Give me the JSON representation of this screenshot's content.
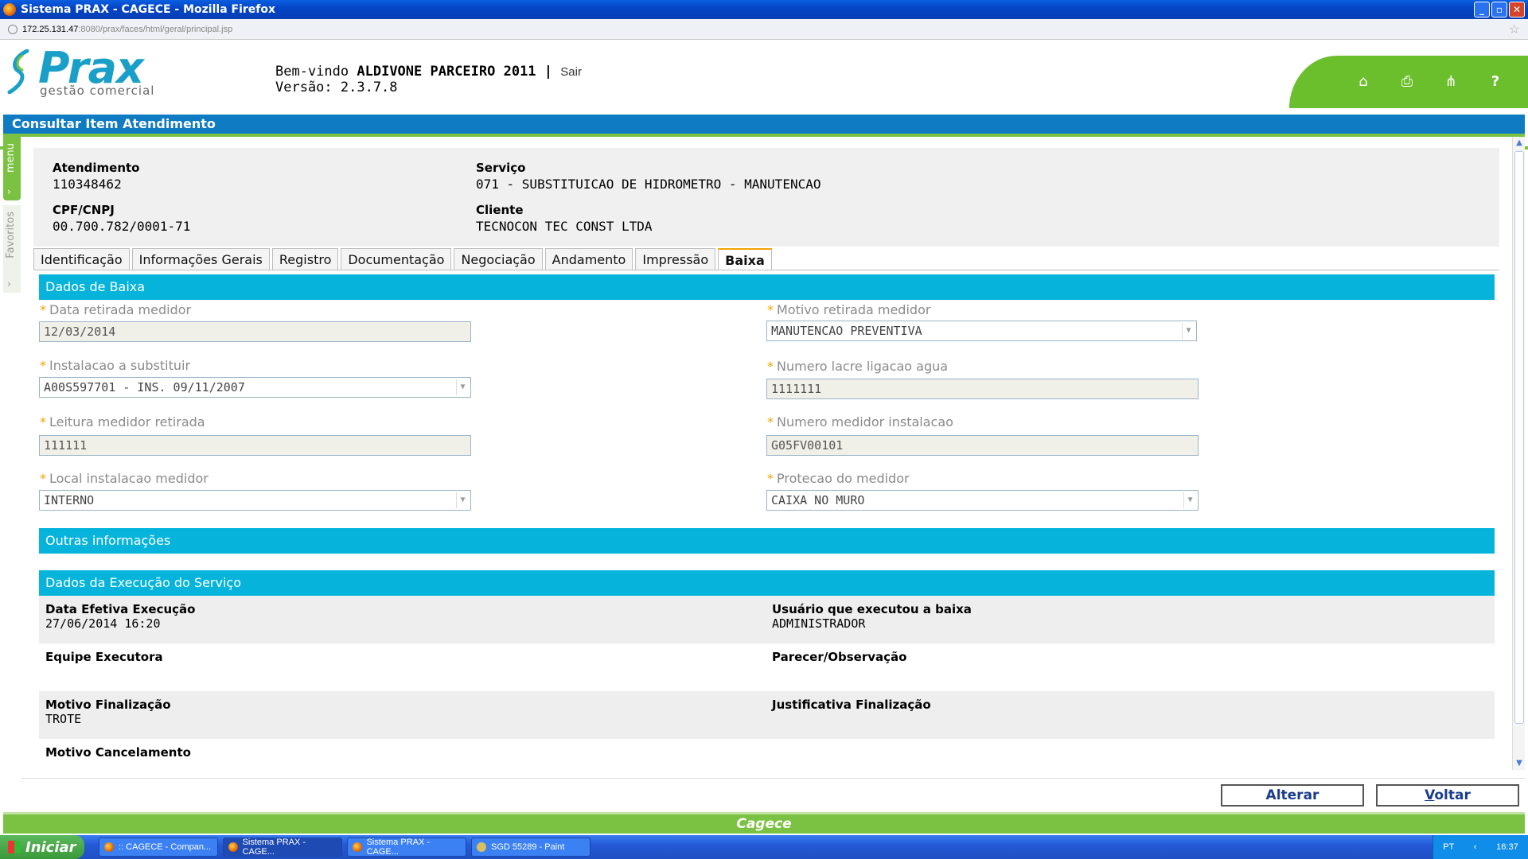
{
  "window": {
    "title": "Sistema PRAX - CAGECE - Mozilla Firefox",
    "buttons": [
      "_",
      "▫",
      "✕"
    ]
  },
  "browser": {
    "address_host": "172.25.131.47",
    "address_path": ":8080/prax/faces/html/geral/principal.jsp"
  },
  "header": {
    "logo": "Prax",
    "logo_sub": "gestão comercial",
    "welcome_prefix": "Bem-vindo",
    "user": "ALDIVONE PARCEIRO 2011",
    "separator": "|",
    "logout": "Sair",
    "version": "Versão: 2.3.7.8",
    "icons": [
      "home-icon",
      "print-icon",
      "sitemap-icon",
      "help-icon"
    ]
  },
  "page": {
    "title": "Consultar Item Atendimento"
  },
  "side": {
    "menu_label": "menu",
    "favorites_label": "Favoritos"
  },
  "info": {
    "atendimento_label": "Atendimento",
    "atendimento_value": "110348462",
    "servico_label": "Serviço",
    "servico_value": "071 - SUBSTITUICAO DE HIDROMETRO - MANUTENCAO",
    "cpf_label": "CPF/CNPJ",
    "cpf_value": "00.700.782/0001-71",
    "cliente_label": "Cliente",
    "cliente_value": "TECNOCON TEC CONST LTDA"
  },
  "tabs": [
    {
      "label": "Identificação"
    },
    {
      "label": "Informações Gerais"
    },
    {
      "label": "Registro"
    },
    {
      "label": "Documentação"
    },
    {
      "label": "Negociação"
    },
    {
      "label": "Andamento"
    },
    {
      "label": "Impressão"
    },
    {
      "label": "Baixa"
    }
  ],
  "baixa": {
    "section_title": "Dados de Baixa",
    "required_mark": "*",
    "data_retirada_label": "Data retirada medidor",
    "data_retirada_value": "12/03/2014",
    "motivo_retirada_label": "Motivo retirada medidor",
    "motivo_retirada_value": "MANUTENCAO PREVENTIVA",
    "instalacao_label": "Instalacao a substituir",
    "instalacao_value": "A00S597701 - INS. 09/11/2007",
    "lacre_label": "Numero lacre ligacao agua",
    "lacre_value": "1111111",
    "leitura_label": "Leitura medidor retirada",
    "leitura_value": "111111",
    "medidor_instalacao_label": "Numero medidor instalacao",
    "medidor_instalacao_value": "G05FV00101",
    "local_label": "Local instalacao medidor",
    "local_value": "INTERNO",
    "protecao_label": "Protecao do medidor",
    "protecao_value": "CAIXA NO MURO"
  },
  "outras": {
    "section_title": "Outras informações"
  },
  "execucao": {
    "section_title": "Dados da Execução do Serviço",
    "data_efetiva_label": "Data Efetiva Execução",
    "data_efetiva_value": "27/06/2014 16:20",
    "usuario_label": "Usuário que executou a baixa",
    "usuario_value": "ADMINISTRADOR",
    "equipe_label": "Equipe Executora",
    "parecer_label": "Parecer/Observação",
    "motivo_finalizacao_label": "Motivo Finalização",
    "motivo_finalizacao_value": "TROTE",
    "justificativa_label": "Justificativa Finalização",
    "motivo_cancelamento_label": "Motivo Cancelamento"
  },
  "actions": {
    "alterar": "Alterar",
    "voltar_first": "V",
    "voltar_rest": "oltar"
  },
  "footer": {
    "brand": "Cagece"
  },
  "taskbar": {
    "start": "Iniciar",
    "tasks": [
      ":: CAGECE - Compan...",
      "Sistema PRAX - CAGE...",
      "Sistema PRAX - CAGE...",
      "SGD 55289 - Paint"
    ],
    "lang": "PT",
    "clock": "16:37"
  },
  "colors": {
    "accent_blue": "#0f7bc2",
    "section_cyan": "#06b4db",
    "brand_green": "#7cc242",
    "required_orange": "#f5a300"
  }
}
